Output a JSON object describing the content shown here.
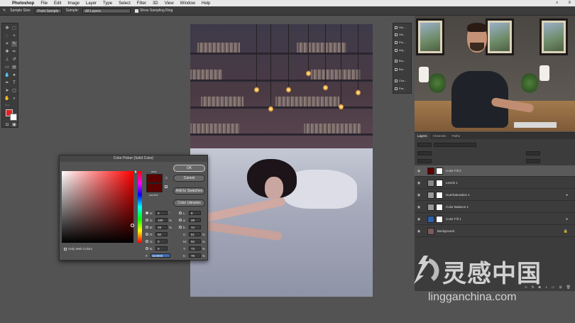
{
  "menubar": {
    "app": "Photoshop",
    "items": [
      "File",
      "Edit",
      "Image",
      "Layer",
      "Type",
      "Select",
      "Filter",
      "3D",
      "View",
      "Window",
      "Help"
    ]
  },
  "options_bar": {
    "sample_size_label": "Sample Size:",
    "sample_size_value": "Point Sample",
    "sample_label": "Sample:",
    "sample_value": "All Layers",
    "show_ring_label": "Show Sampling Ring"
  },
  "color_picker": {
    "title": "Color Picker (Solid Color)",
    "ok_label": "OK",
    "cancel_label": "Cancel",
    "add_swatches_label": "Add to Swatches",
    "libraries_label": "Color Libraries",
    "new_label": "new",
    "current_label": "current",
    "only_web_label": "Only Web Colors",
    "new_color": "#5c0000",
    "current_color": "#5c0000",
    "fields_left": [
      {
        "name": "H:",
        "value": "0",
        "unit": "°",
        "selected": true
      },
      {
        "name": "S:",
        "value": "100",
        "unit": "%",
        "selected": false
      },
      {
        "name": "B:",
        "value": "29",
        "unit": "%",
        "selected": false
      },
      {
        "name": "R:",
        "value": "60",
        "unit": "",
        "selected": false
      },
      {
        "name": "G:",
        "value": "0",
        "unit": "",
        "selected": false
      },
      {
        "name": "B:",
        "value": "0",
        "unit": "",
        "selected": false
      }
    ],
    "fields_right": [
      {
        "name": "L:",
        "value": "8",
        "unit": ""
      },
      {
        "name": "a:",
        "value": "29",
        "unit": ""
      },
      {
        "name": "b:",
        "value": "14",
        "unit": ""
      },
      {
        "name": "C:",
        "value": "51",
        "unit": "%"
      },
      {
        "name": "M:",
        "value": "92",
        "unit": "%"
      },
      {
        "name": "Y:",
        "value": "73",
        "unit": "%"
      },
      {
        "name": "K:",
        "value": "78",
        "unit": "%"
      }
    ],
    "hex_label": "#",
    "hex_value": "5c0000"
  },
  "panels_mini": [
    "His...",
    "His...",
    "Pro...",
    "Adj...",
    "Bru...",
    "Bru...",
    "Cha...",
    "Par..."
  ],
  "layers_panel": {
    "tabs": [
      "Layers",
      "Channels",
      "Paths"
    ],
    "layers": [
      {
        "name": "Color Fill 2",
        "thumb": "#5c0000",
        "mask": true,
        "selected": true
      },
      {
        "name": "Levels 1",
        "thumb": "#888888",
        "mask": true,
        "selected": false
      },
      {
        "name": "Hue/Saturation 1",
        "thumb": "#999999",
        "mask": true,
        "selected": false
      },
      {
        "name": "Color Balance 1",
        "thumb": "#999999",
        "mask": true,
        "selected": false
      },
      {
        "name": "Color Fill 1",
        "thumb": "#2f5fa8",
        "mask": true,
        "selected": false
      },
      {
        "name": "Background",
        "thumb": "#7a5a5a",
        "mask": false,
        "selected": false
      }
    ]
  },
  "watermark": {
    "chinese": "灵感中国",
    "url": "lingganchina.com"
  },
  "colors": {
    "foreground": "#e62020",
    "background": "#ffffff",
    "accent": "#3d6db5"
  }
}
